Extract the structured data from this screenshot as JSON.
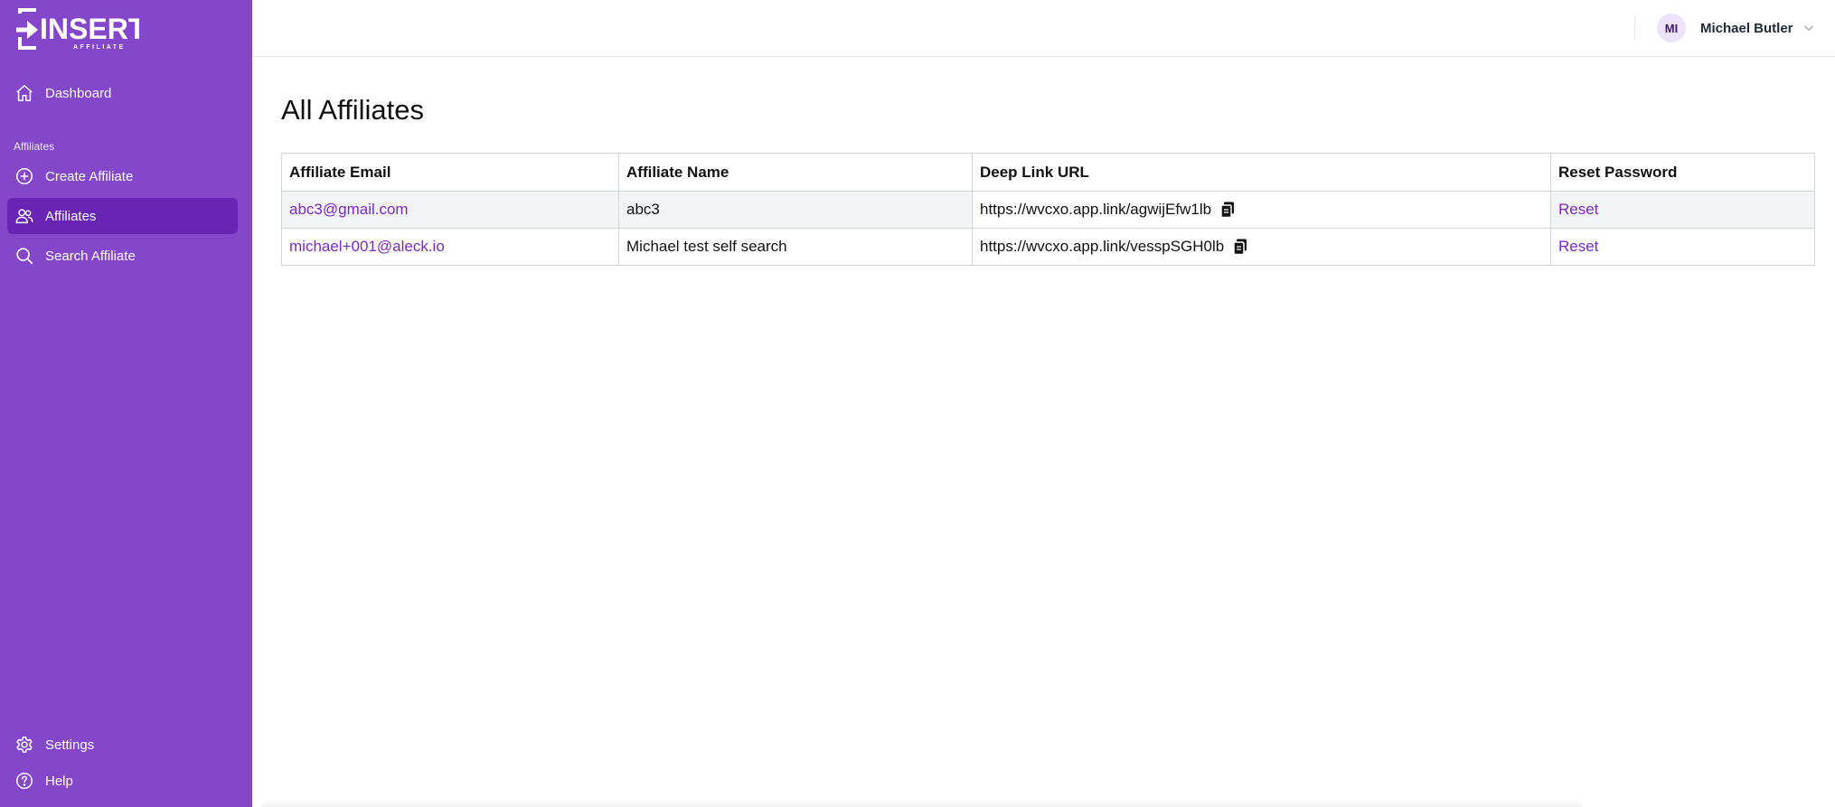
{
  "brand": {
    "logo_text": "INSERT",
    "logo_subtext": "AFFILIATE",
    "sidebar_color": "#8447c9",
    "active_color": "#6a24b3",
    "link_color": "#7a2bc4"
  },
  "sidebar": {
    "dashboard": {
      "label": "Dashboard",
      "icon": "home-icon"
    },
    "section_label": "Affiliates",
    "create": {
      "label": "Create Affiliate",
      "icon": "plus-circle-icon"
    },
    "affiliates": {
      "label": "Affiliates",
      "icon": "users-icon",
      "active": true
    },
    "search": {
      "label": "Search Affiliate",
      "icon": "search-icon"
    },
    "settings": {
      "label": "Settings",
      "icon": "gear-icon"
    },
    "help": {
      "label": "Help",
      "icon": "question-circle-icon"
    }
  },
  "header": {
    "avatar_initials": "MI",
    "user_name": "Michael Butler"
  },
  "main": {
    "title": "All Affiliates",
    "table": {
      "columns": [
        "Affiliate Email",
        "Affiliate Name",
        "Deep Link URL",
        "Reset Password"
      ],
      "rows": [
        {
          "email": "abc3@gmail.com",
          "name": "abc3",
          "deep_link": "https://wvcxo.app.link/agwijEfw1lb",
          "reset": "Reset"
        },
        {
          "email": "michael+001@aleck.io",
          "name": "Michael test self search",
          "deep_link": "https://wvcxo.app.link/vesspSGH0lb",
          "reset": "Reset"
        }
      ]
    }
  }
}
